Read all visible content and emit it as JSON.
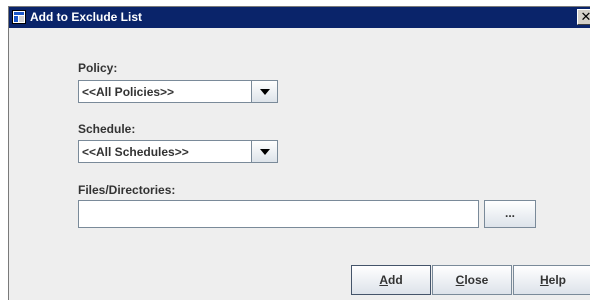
{
  "window": {
    "title": "Add to Exclude List",
    "close_glyph": "✕",
    "icon": "app-window-icon",
    "title_bar_color": "#0a246a"
  },
  "form": {
    "policy": {
      "label": "Policy:",
      "value": "<<All Policies>>"
    },
    "schedule": {
      "label": "Schedule:",
      "value": "<<All Schedules>>"
    },
    "files": {
      "label": "Files/Directories:",
      "value": "",
      "browse_label": "..."
    }
  },
  "buttons": {
    "add": {
      "mnemonic": "A",
      "rest": "dd"
    },
    "close": {
      "mnemonic": "C",
      "rest": "lose"
    },
    "help": {
      "mnemonic": "H",
      "rest": "elp"
    }
  }
}
